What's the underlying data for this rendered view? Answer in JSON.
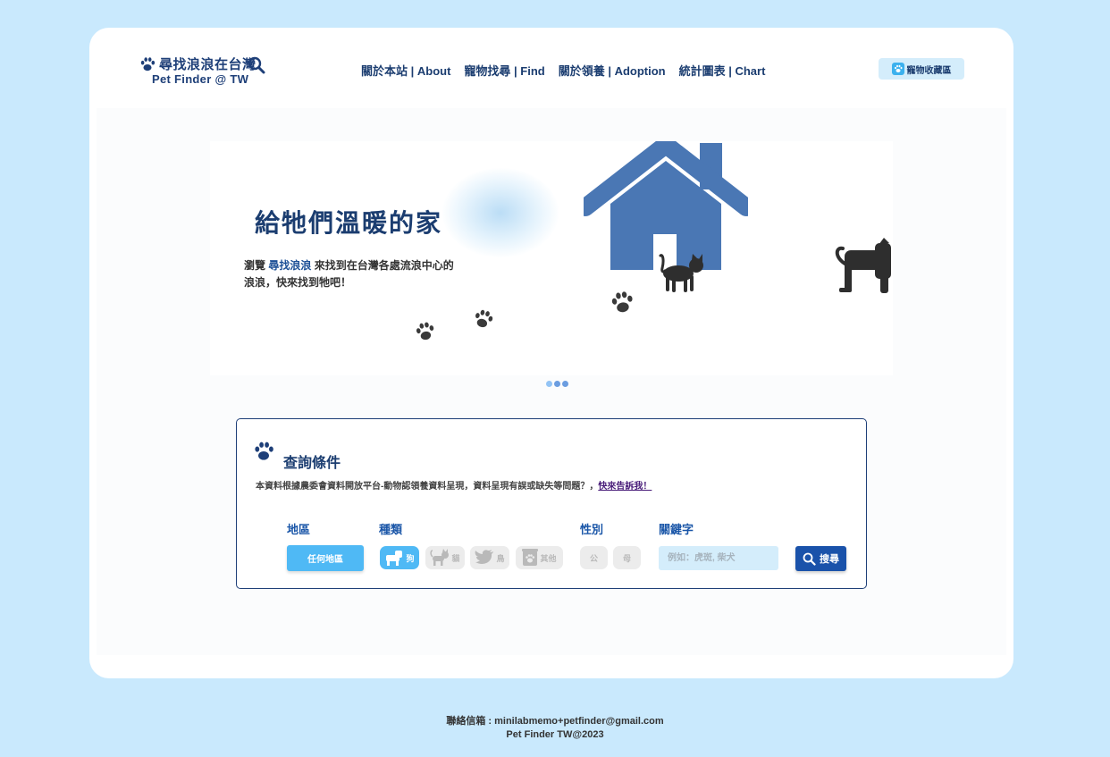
{
  "header": {
    "logo_cn": "尋找浪浪在台灣",
    "logo_en": "Pet Finder @ TW",
    "nav": [
      "關於本站 | About",
      "寵物找尋 | Find",
      "關於領養 | Adoption",
      "統計圖表 | Chart"
    ],
    "favorites_label": "寵物收藏區"
  },
  "hero": {
    "title": "給牠們溫暖的家",
    "desc_before": "瀏覽 ",
    "desc_highlight": "尋找浪浪",
    "desc_after": " 來找到在台灣各處流浪中心的浪浪，快來找到牠吧！",
    "slides_count": 3,
    "active_slide": 1
  },
  "search": {
    "title": "查詢條件",
    "note": "本資料根據農委會資料開放平台-動物認領養資料呈現，資料呈現有誤或缺失等問題？，",
    "note_link": "快來告訴我！",
    "labels": {
      "region": "地區",
      "type": "種類",
      "sex": "性別",
      "keyword": "關鍵字"
    },
    "region_button": "任何地區",
    "types": [
      "狗",
      "貓",
      "鳥",
      "其他"
    ],
    "sexes": [
      "公",
      "母"
    ],
    "keyword_placeholder": "例如：虎斑, 柴犬",
    "search_button": "搜尋"
  },
  "footer": {
    "contact": "聯絡信箱 : minilabmemo+petfinder@gmail.com",
    "copyright": "Pet Finder TW@2023"
  },
  "colors": {
    "page_bg": "#c9e9fd",
    "brand_navy": "#1b3d70",
    "accent_blue": "#4fb9f5",
    "house_blue": "#4a77b4"
  }
}
